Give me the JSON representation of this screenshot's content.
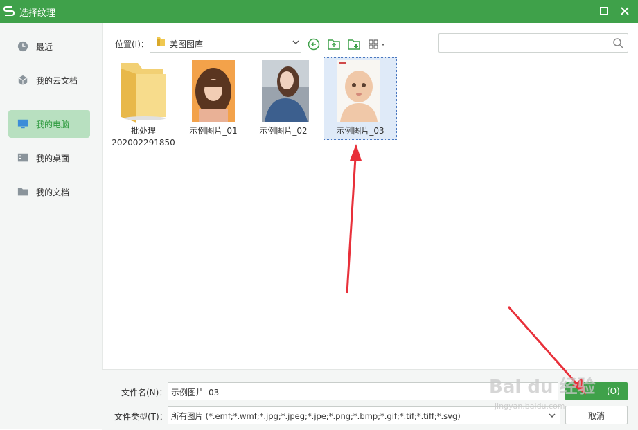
{
  "window": {
    "title": "选择纹理",
    "logo_letter": "S"
  },
  "sidebar": {
    "items": [
      {
        "label": "最近",
        "icon": "clock-icon"
      },
      {
        "label": "我的云文档",
        "icon": "cloud-cube-icon"
      },
      {
        "label": "我的电脑",
        "icon": "monitor-icon",
        "active": true
      },
      {
        "label": "我的桌面",
        "icon": "desktop-icon"
      },
      {
        "label": "我的文档",
        "icon": "folder-icon"
      }
    ]
  },
  "toolbar": {
    "location_label": "位置(I)：",
    "location_value": "美图图库",
    "search_placeholder": ""
  },
  "files": [
    {
      "name_line1": "批处理",
      "name_line2": "202002291850",
      "type": "folder"
    },
    {
      "name_line1": "示例图片_01",
      "type": "image"
    },
    {
      "name_line1": "示例图片_02",
      "type": "image"
    },
    {
      "name_line1": "示例图片_03",
      "type": "image",
      "selected": true
    }
  ],
  "bottom": {
    "filename_label": "文件名(N)：",
    "filename_value": "示例图片_03",
    "filetype_label": "文件类型(T)：",
    "filetype_value": "所有图片 (*.emf;*.wmf;*.jpg;*.jpeg;*.jpe;*.png;*.bmp;*.gif;*.tif;*.tiff;*.svg)",
    "open_label": "(O)",
    "cancel_label": "取消"
  },
  "watermark": {
    "text": "Bai du 经验",
    "subtext": "jingyan.baidu.com"
  },
  "colors": {
    "accent": "#3fa14a",
    "active_bg": "#b8e0c0",
    "arrow": "#e8303a"
  }
}
